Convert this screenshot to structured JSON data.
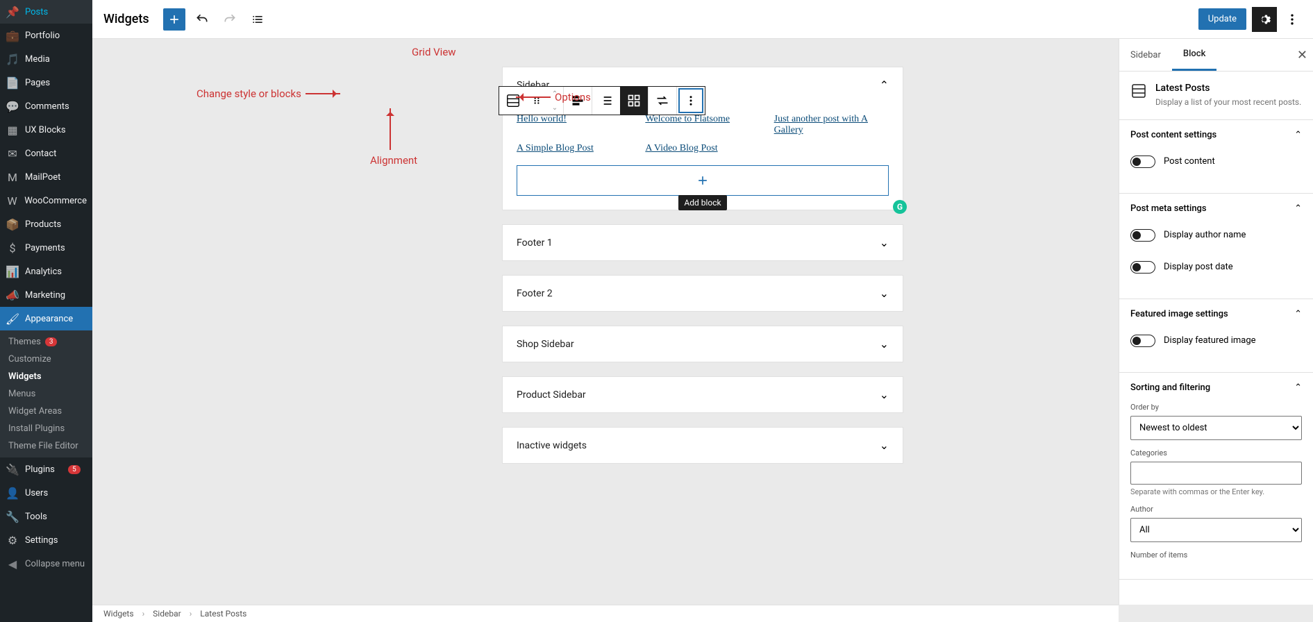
{
  "sidebar": {
    "items": [
      {
        "label": "Posts",
        "icon": "pin"
      },
      {
        "label": "Portfolio",
        "icon": "briefcase"
      },
      {
        "label": "Media",
        "icon": "media"
      },
      {
        "label": "Pages",
        "icon": "pages"
      },
      {
        "label": "Comments",
        "icon": "comment"
      },
      {
        "label": "UX Blocks",
        "icon": "blocks"
      },
      {
        "label": "Contact",
        "icon": "mail"
      },
      {
        "label": "MailPoet",
        "icon": "mailpoet"
      },
      {
        "label": "WooCommerce",
        "icon": "woo"
      },
      {
        "label": "Products",
        "icon": "archive"
      },
      {
        "label": "Payments",
        "icon": "payments"
      },
      {
        "label": "Analytics",
        "icon": "analytics"
      },
      {
        "label": "Marketing",
        "icon": "megaphone"
      },
      {
        "label": "Appearance",
        "icon": "brush",
        "active": true
      },
      {
        "label": "Plugins",
        "icon": "plugin",
        "badge": "5"
      },
      {
        "label": "Users",
        "icon": "user"
      },
      {
        "label": "Tools",
        "icon": "wrench"
      },
      {
        "label": "Settings",
        "icon": "settings"
      }
    ],
    "submenu": [
      {
        "label": "Themes",
        "badge": "3"
      },
      {
        "label": "Customize"
      },
      {
        "label": "Widgets",
        "active": true
      },
      {
        "label": "Menus"
      },
      {
        "label": "Widget Areas"
      },
      {
        "label": "Install Plugins"
      },
      {
        "label": "Theme File Editor"
      }
    ],
    "collapse": "Collapse menu"
  },
  "toolbar": {
    "title": "Widgets",
    "update": "Update"
  },
  "annotations": {
    "grid_view": "Grid View",
    "change_style": "Change style or blocks",
    "alignment": "Alignment",
    "options": "Options"
  },
  "canvas": {
    "sidebar_area": {
      "title": "Sidebar",
      "posts": [
        "Hello world!",
        "Welcome to Flatsome",
        "Just another post with A Gallery",
        "A Simple Blog Post",
        "A Video Blog Post"
      ],
      "add_block_tooltip": "Add block"
    },
    "areas": [
      "Footer 1",
      "Footer 2",
      "Shop Sidebar",
      "Product Sidebar",
      "Inactive widgets"
    ]
  },
  "inspector": {
    "tabs": {
      "sidebar": "Sidebar",
      "block": "Block"
    },
    "block_info": {
      "title": "Latest Posts",
      "desc": "Display a list of your most recent posts."
    },
    "panels": {
      "post_content": {
        "title": "Post content settings",
        "toggle": "Post content"
      },
      "post_meta": {
        "title": "Post meta settings",
        "author": "Display author name",
        "date": "Display post date"
      },
      "featured": {
        "title": "Featured image settings",
        "toggle": "Display featured image"
      },
      "sorting": {
        "title": "Sorting and filtering",
        "order_by_label": "Order by",
        "order_by_value": "Newest to oldest",
        "categories_label": "Categories",
        "categories_help": "Separate with commas or the Enter key.",
        "author_label": "Author",
        "author_value": "All",
        "number_label": "Number of items"
      }
    }
  },
  "breadcrumb": [
    "Widgets",
    "Sidebar",
    "Latest Posts"
  ]
}
